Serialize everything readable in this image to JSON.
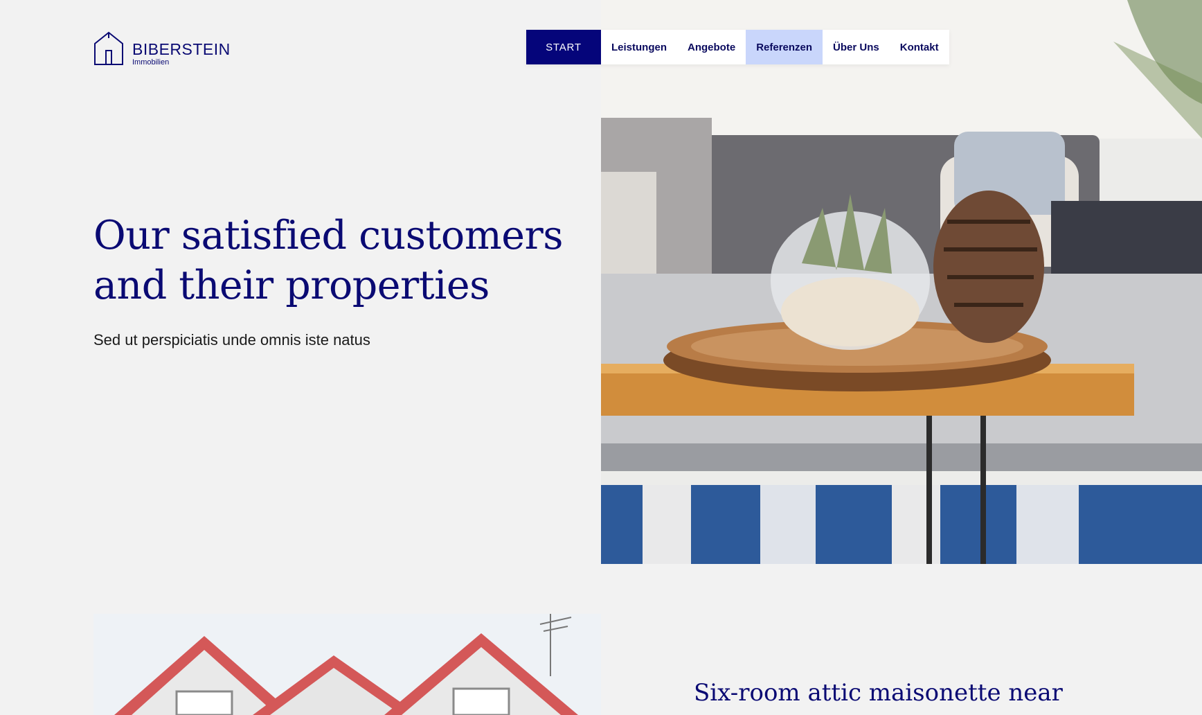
{
  "brand": {
    "name": "BIBERSTEIN",
    "subtitle": "Immobilien"
  },
  "nav": {
    "items": [
      {
        "label": "START"
      },
      {
        "label": "Leistungen"
      },
      {
        "label": "Angebote"
      },
      {
        "label": "Referenzen"
      },
      {
        "label": "Über Uns"
      },
      {
        "label": "Kontakt"
      }
    ],
    "active": "Referenzen"
  },
  "hero": {
    "title": "Our satisfied customers and their properties",
    "subtitle": "Sed ut perspiciatis unde omnis iste natus"
  },
  "property": {
    "title": "Six-room attic maisonette near"
  },
  "colors": {
    "accent": "#05057a",
    "heading": "#0a0a73",
    "active_nav": "#c9d6fb",
    "background": "#f2f2f2"
  }
}
